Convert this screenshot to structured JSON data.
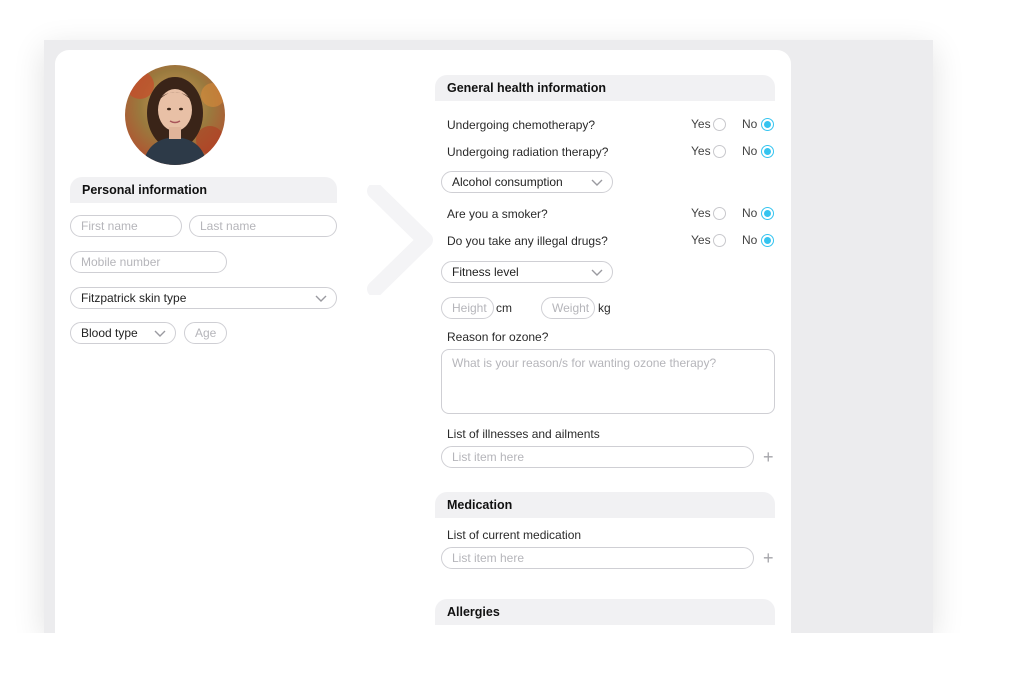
{
  "personal": {
    "header": "Personal information",
    "first_name_placeholder": "First name",
    "last_name_placeholder": "Last name",
    "mobile_placeholder": "Mobile number",
    "skin_type_label": "Fitzpatrick skin type",
    "blood_type_label": "Blood type",
    "age_placeholder": "Age"
  },
  "general": {
    "header": "General health information",
    "chemo_q": "Undergoing chemotherapy?",
    "radiation_q": "Undergoing radiation therapy?",
    "alcohol_label": "Alcohol consumption",
    "smoker_q": "Are you a smoker?",
    "drugs_q": "Do you take any illegal drugs?",
    "fitness_label": "Fitness level",
    "height_placeholder": "Height",
    "height_unit": "cm",
    "weight_placeholder": "Weight",
    "weight_unit": "kg",
    "reason_label": "Reason for ozone?",
    "reason_placeholder": "What is your reason/s for wanting ozone therapy?",
    "illness_label": "List of illnesses and ailments",
    "illness_placeholder": "List item here",
    "yes": "Yes",
    "no": "No"
  },
  "medication": {
    "header": "Medication",
    "list_label": "List of current medication",
    "list_placeholder": "List item here"
  },
  "allergies": {
    "header": "Allergies"
  },
  "colors": {
    "accent": "#35c4f0",
    "section_bg": "#f1f1f3",
    "border": "#cfcfd4"
  },
  "answers": {
    "chemotherapy": "No",
    "radiation": "No",
    "smoker": "No",
    "drugs": "No"
  }
}
